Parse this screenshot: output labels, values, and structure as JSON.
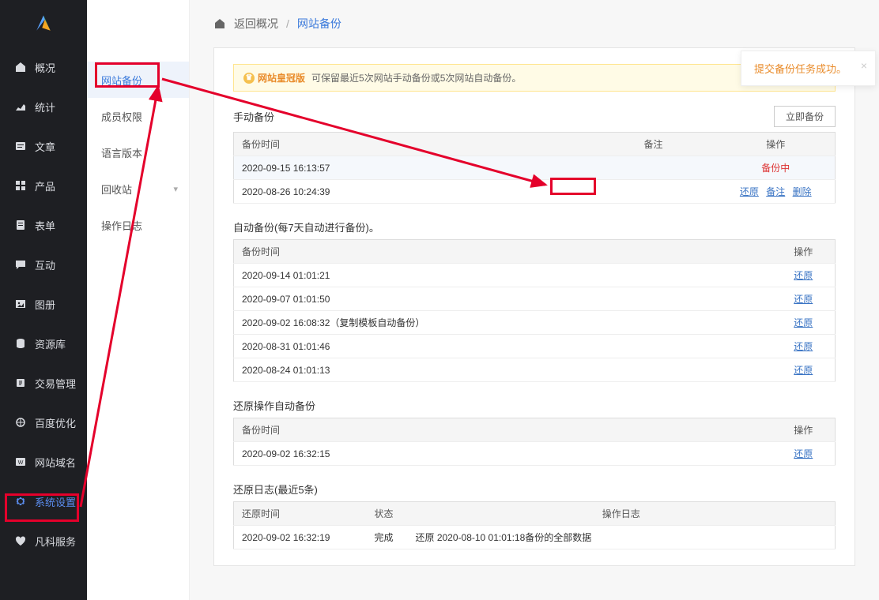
{
  "toast": {
    "text": "提交备份任务成功。"
  },
  "sidebar": {
    "items": [
      {
        "icon": "home",
        "label": "概况"
      },
      {
        "icon": "stats",
        "label": "统计"
      },
      {
        "icon": "article",
        "label": "文章"
      },
      {
        "icon": "product",
        "label": "产品"
      },
      {
        "icon": "form",
        "label": "表单"
      },
      {
        "icon": "interact",
        "label": "互动"
      },
      {
        "icon": "gallery",
        "label": "图册"
      },
      {
        "icon": "resource",
        "label": "资源库"
      },
      {
        "icon": "trade",
        "label": "交易管理"
      },
      {
        "icon": "baidu",
        "label": "百度优化"
      },
      {
        "icon": "domain",
        "label": "网站域名"
      },
      {
        "icon": "settings",
        "label": "系统设置"
      },
      {
        "icon": "service",
        "label": "凡科服务"
      }
    ],
    "active_index": 11
  },
  "subnav": {
    "items": [
      {
        "label": "网站备份",
        "active": true
      },
      {
        "label": "成员权限"
      },
      {
        "label": "语言版本"
      },
      {
        "label": "回收站",
        "has_chevron": true
      },
      {
        "label": "操作日志"
      }
    ]
  },
  "breadcrumb": {
    "back": "返回概况",
    "sep": "/",
    "current": "网站备份"
  },
  "info_banner": {
    "badge": "网站皇冠版",
    "text": "可保留最近5次网站手动备份或5次网站自动备份。"
  },
  "manual": {
    "title": "手动备份",
    "button": "立即备份",
    "columns": {
      "time": "备份时间",
      "note": "备注",
      "ops": "操作"
    },
    "rows": [
      {
        "time": "2020-09-15 16:13:57",
        "ops_status": "备份中"
      },
      {
        "time": "2020-08-26 10:24:39",
        "restore": "还原",
        "note_action": "备注",
        "del": "删除"
      }
    ]
  },
  "auto": {
    "title": "自动备份(每7天自动进行备份)。",
    "columns": {
      "time": "备份时间",
      "ops": "操作"
    },
    "rows": [
      {
        "time": "2020-09-14 01:01:21",
        "restore": "还原"
      },
      {
        "time": "2020-09-07 01:01:50",
        "restore": "还原"
      },
      {
        "time": "2020-09-02 16:08:32（复制模板自动备份）",
        "restore": "还原"
      },
      {
        "time": "2020-08-31 01:01:46",
        "restore": "还原"
      },
      {
        "time": "2020-08-24 01:01:13",
        "restore": "还原"
      }
    ]
  },
  "restore_auto": {
    "title": "还原操作自动备份",
    "columns": {
      "time": "备份时间",
      "ops": "操作"
    },
    "rows": [
      {
        "time": "2020-09-02 16:32:15",
        "restore": "还原"
      }
    ]
  },
  "restore_log": {
    "title": "还原日志(最近5条)",
    "columns": {
      "time": "还原时间",
      "status": "状态",
      "log": "操作日志"
    },
    "rows": [
      {
        "time": "2020-09-02 16:32:19",
        "status": "完成",
        "log": "还原 2020-08-10 01:01:18备份的全部数据"
      }
    ]
  }
}
